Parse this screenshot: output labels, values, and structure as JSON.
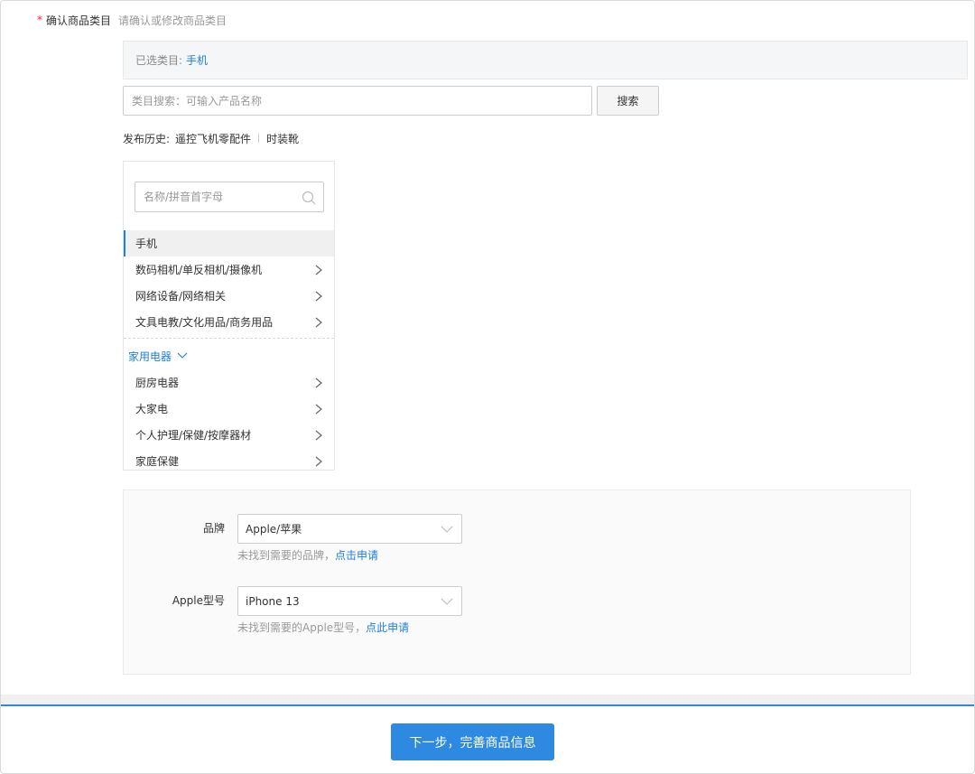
{
  "header": {
    "required_mark": "*",
    "title": "确认商品类目",
    "hint": "请确认或修改商品类目"
  },
  "selected": {
    "label": "已选类目:",
    "value": "手机"
  },
  "search": {
    "placeholder": "类目搜索：可输入产品名称",
    "button_label": "搜索"
  },
  "history": {
    "label": "发布历史:",
    "items": [
      "遥控飞机零配件",
      "时装靴"
    ]
  },
  "category_panel": {
    "filter_placeholder": "名称/拼音首字母",
    "items": [
      {
        "label": "手机",
        "active": true,
        "has_children": false
      },
      {
        "label": "数码相机/单反相机/摄像机",
        "has_children": true
      },
      {
        "label": "网络设备/网络相关",
        "has_children": true
      },
      {
        "label": "文具电教/文化用品/商务用品",
        "has_children": true
      }
    ],
    "group": {
      "label": "家用电器",
      "items": [
        {
          "label": "厨房电器",
          "has_children": true
        },
        {
          "label": "大家电",
          "has_children": true
        },
        {
          "label": "个人护理/保健/按摩器材",
          "has_children": true
        },
        {
          "label": "家庭保健",
          "has_children": true
        }
      ]
    }
  },
  "properties": {
    "brand": {
      "label": "品牌",
      "value": "Apple/苹果",
      "hint": "未找到需要的品牌，",
      "link": "点击申请"
    },
    "model": {
      "label": "Apple型号",
      "value": "iPhone 13",
      "hint": "未找到需要的Apple型号，",
      "link": "点此申请"
    }
  },
  "footer": {
    "next_label": "下一步，完善商品信息"
  },
  "colors": {
    "accent": "#2d8ae0",
    "link": "#1f7fdb",
    "required": "#f5222d"
  }
}
